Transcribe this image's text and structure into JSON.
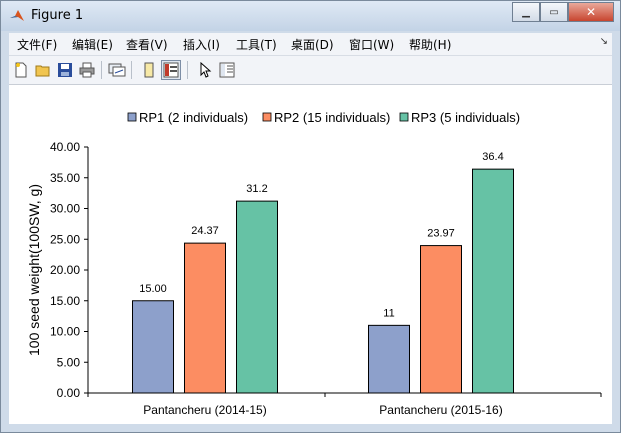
{
  "window": {
    "title": "Figure 1"
  },
  "menu": [
    "文件(F)",
    "编辑(E)",
    "查看(V)",
    "插入(I)",
    "工具(T)",
    "桌面(D)",
    "窗口(W)",
    "帮助(H)"
  ],
  "toolbar": {
    "icons": [
      "new-figure-icon",
      "open-file-icon",
      "save-icon",
      "print-icon",
      "link-plot-icon",
      "hide-plot-tools-icon",
      "show-plot-tools-icon",
      "edit-plot-arrow-icon",
      "plot-browser-icon"
    ]
  },
  "colors": {
    "RP1": "#8da0cb",
    "RP2": "#fc8d62",
    "RP3": "#66c2a5"
  },
  "chart_data": {
    "type": "bar",
    "categories": [
      "Pantancheru (2014-15)",
      "Pantancheru (2015-16)"
    ],
    "series": [
      {
        "name": "RP1 (2 individuals)",
        "values": [
          15.0,
          11
        ],
        "labels": [
          "15.00",
          "11"
        ]
      },
      {
        "name": "RP2 (15 individuals)",
        "values": [
          24.37,
          23.97
        ],
        "labels": [
          "24.37",
          "23.97"
        ]
      },
      {
        "name": "RP3 (5 individuals)",
        "values": [
          31.2,
          36.4
        ],
        "labels": [
          "31.2",
          "36.4"
        ]
      }
    ],
    "ylabel": "100 seed weight(100SW, g)",
    "xlabel": "",
    "ylim": [
      0,
      40
    ],
    "yticks": [
      "0.00",
      "5.00",
      "10.00",
      "15.00",
      "20.00",
      "25.00",
      "30.00",
      "35.00",
      "40.00"
    ],
    "legend_position": "top",
    "grid": false
  }
}
